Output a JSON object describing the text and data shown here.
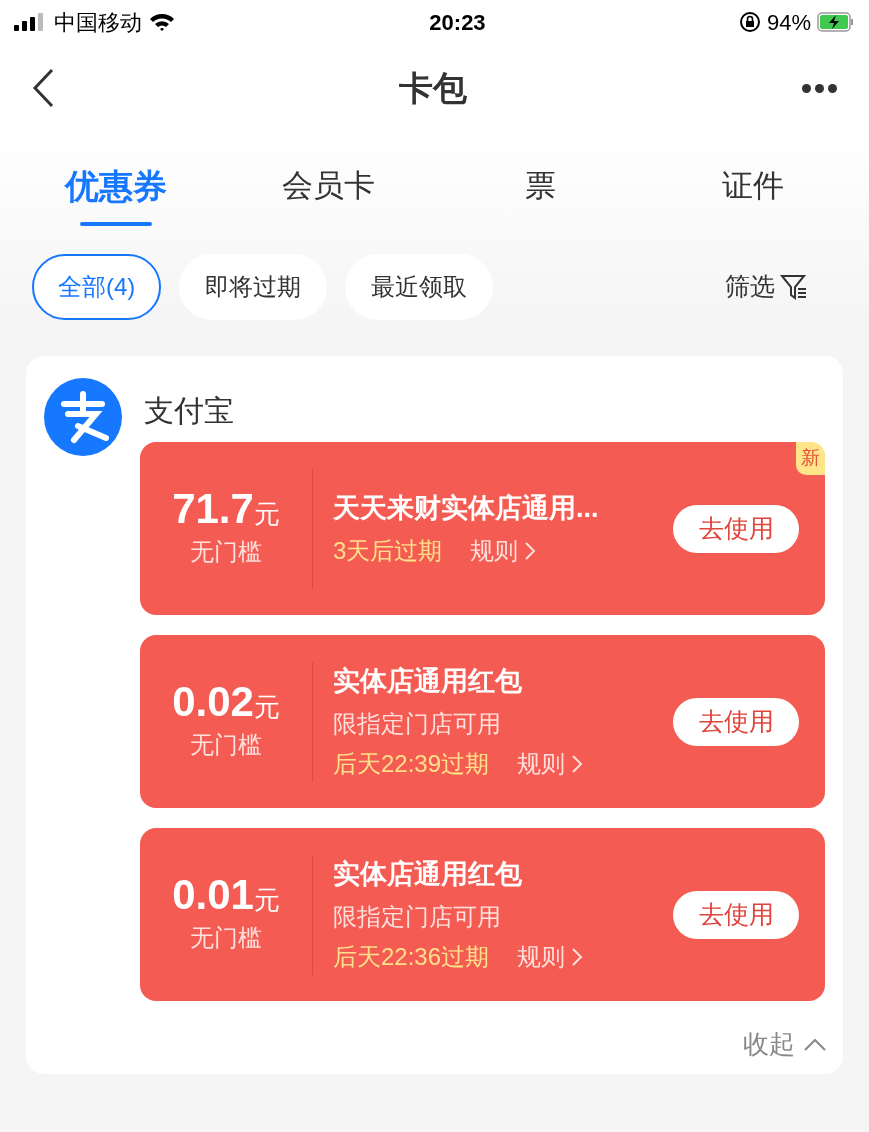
{
  "status_bar": {
    "carrier": "中国移动",
    "time": "20:23",
    "battery": "94%"
  },
  "nav": {
    "title": "卡包"
  },
  "tabs": [
    {
      "label": "优惠券",
      "selected": true
    },
    {
      "label": "会员卡",
      "selected": false
    },
    {
      "label": "票",
      "selected": false
    },
    {
      "label": "证件",
      "selected": false
    }
  ],
  "filters": [
    {
      "label": "全部(4)",
      "selected": true
    },
    {
      "label": "即将过期",
      "selected": false
    },
    {
      "label": "最近领取",
      "selected": false
    }
  ],
  "filter_button": "筛选",
  "merchant": {
    "name": "支付宝",
    "coupons": [
      {
        "amount": "71.7",
        "unit": "元",
        "threshold": "无门槛",
        "title": "天天来财实体店通用...",
        "expiry": "3天后过期",
        "rules": "规则",
        "action": "去使用",
        "badge": "新"
      },
      {
        "amount": "0.02",
        "unit": "元",
        "threshold": "无门槛",
        "title": "实体店通用红包",
        "subtitle": "限指定门店可用",
        "expiry": "后天22:39过期",
        "rules": "规则",
        "action": "去使用"
      },
      {
        "amount": "0.01",
        "unit": "元",
        "threshold": "无门槛",
        "title": "实体店通用红包",
        "subtitle": "限指定门店可用",
        "expiry": "后天22:36过期",
        "rules": "规则",
        "action": "去使用"
      }
    ]
  },
  "collapse": "收起"
}
